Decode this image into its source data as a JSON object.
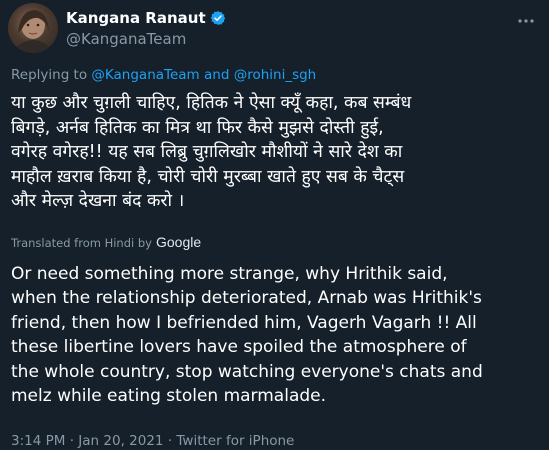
{
  "author": {
    "name": "Kangana Ranaut",
    "handle": "@KanganaTeam",
    "verified_color": "#1da1f2"
  },
  "more_icon": "more-dots-icon",
  "replying": {
    "prefix": "Replying to",
    "mention1": "@KanganaTeam",
    "joiner": "and",
    "mention2": "@rohini_sgh"
  },
  "tweet": {
    "hindi_lines": [
      "या कुछ और चुग़ली चाहिए, हितिक ने ऐसा क्यूँ कहा, कब सम्बंध",
      "बिगड़े, अर्नब हितिक का मित्र था फिर कैसे मुझसे दोस्ती हुई,",
      "वगेरह वगेरह!! यह सब लिब्रु चुग़लिखोर मौशीयों ने सारे देश का",
      "माहौल ख़राब किया है, चोरी चोरी मुरब्बा खाते हुए सब के चैट्स",
      "और मेल्ज़ देखना बंद करो ।"
    ],
    "translated_from": "Translated from Hindi by",
    "translator": "Google",
    "english_lines": [
      "Or need something more strange, why Hrithik said,",
      "when the relationship deteriorated, Arnab was Hrithik's",
      "friend, then how I befriended him, Vagerh Vagarh !! All",
      "these libertine lovers have spoiled the atmosphere of",
      "the whole country, stop watching everyone's chats and",
      "melz while eating stolen marmalade."
    ]
  },
  "meta": {
    "time": "3:14 PM",
    "separator": "·",
    "date": "Jan 20, 2021",
    "source": "Twitter for iPhone"
  },
  "colors": {
    "background": "#15202b",
    "text": "#ffffff",
    "secondary": "#8899a6",
    "accent": "#1da1f2"
  }
}
